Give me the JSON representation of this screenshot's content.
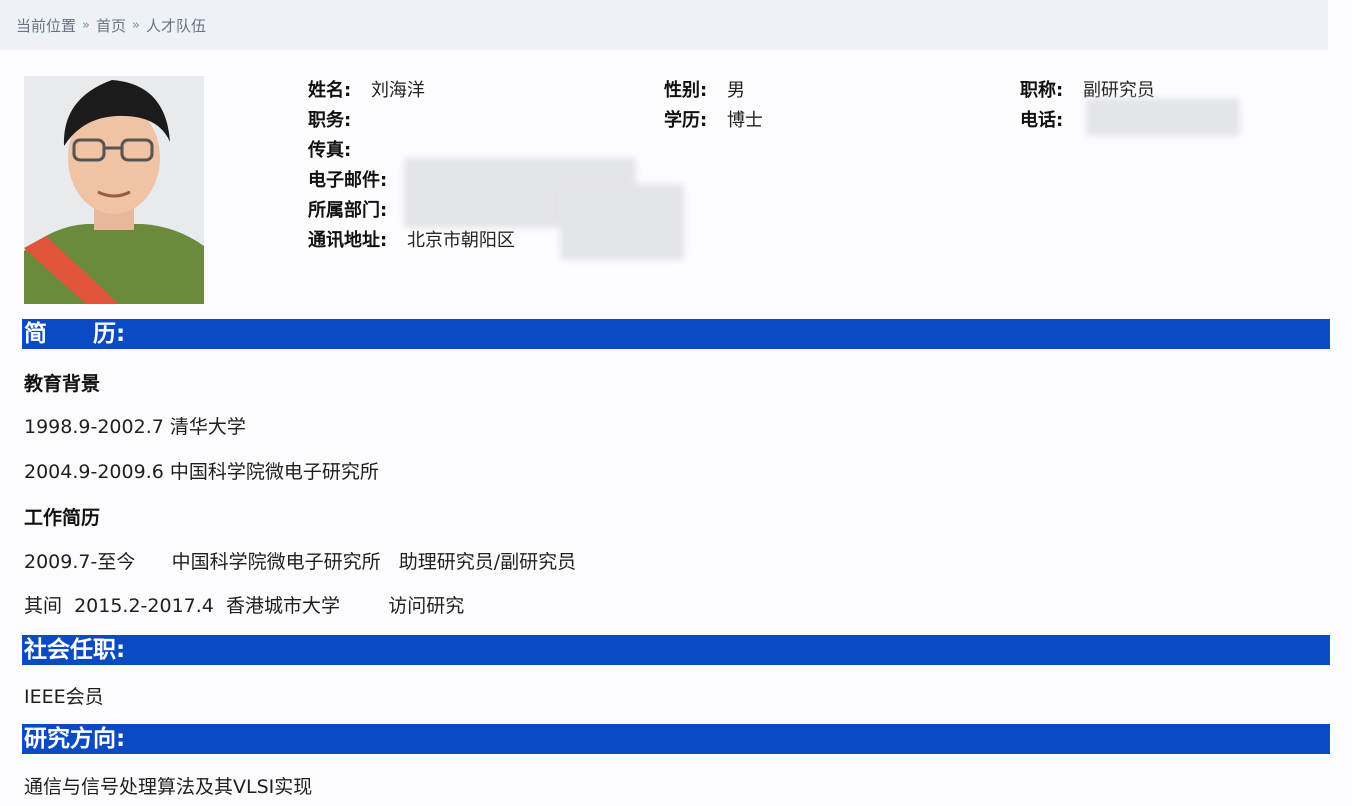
{
  "breadcrumb": {
    "items": [
      "当前位置",
      "首页",
      "人才队伍"
    ],
    "separator": "»"
  },
  "profile": {
    "name_label": "姓名:",
    "name_value": "刘海洋",
    "gender_label": "性别:",
    "gender_value": "男",
    "title_label": "职称:",
    "title_value": "副研究员",
    "position_label": "职务:",
    "position_value": "",
    "education_label": "学历:",
    "education_value": "博士",
    "phone_label": "电话:",
    "fax_label": "传真:",
    "email_label": "电子邮件:",
    "department_label": "所属部门:",
    "address_label": "通讯地址:",
    "address_value": "北京市朝阳区"
  },
  "sections": {
    "resume_title": "简　　历:",
    "education_heading": "教育背景",
    "education_items": [
      "1998.9-2002.7 清华大学",
      "2004.9-2009.6 中国科学院微电子研究所"
    ],
    "work_heading": "工作简历",
    "work_items": [
      "2009.7-至今      中国科学院微电子研究所   助理研究员/副研究员",
      "其间  2015.2-2017.4  香港城市大学        访问研究"
    ],
    "social_title": "社会任职:",
    "social_items": [
      "IEEE会员"
    ],
    "research_title": "研究方向:",
    "research_items": [
      "通信与信号处理算法及其VLSI实现"
    ]
  },
  "colors": {
    "section_bar": "#0a4bc4",
    "breadcrumb_bg": "#eef2f8"
  }
}
